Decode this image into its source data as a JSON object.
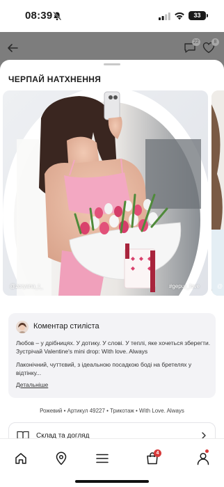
{
  "status_bar": {
    "time": "08:39",
    "battery": "33",
    "icons": [
      "bell-slash-icon",
      "signal-icon",
      "wifi-icon",
      "battery-icon"
    ]
  },
  "header": {
    "back_icon": "arrow-left-icon",
    "chat_badge": "22",
    "favorites_badge": "8"
  },
  "sheet": {
    "title": "ЧЕРПАЙ НАТХНЕННЯ",
    "photo": {
      "author": "@zoryana_t_",
      "hashtag": "#gepur_love",
      "next_author": "@"
    },
    "stylist": {
      "title": "Коментар стиліста",
      "paragraph_1": "Любов – у дрібницях. У дотику. У слові. У теплі, яке хочеться зберегти. Зустрічай Valentine's mini drop: With love. Always",
      "paragraph_2": "Лаконічний, чуттєвий, з ідеальною посадкою боді на бретелях у відтінку...",
      "more_link": "Детальніше"
    },
    "meta": "Рожевий • Артикул 49227 • Трикотаж • With Love. Always",
    "composition_label": "Склад та догляд"
  },
  "tab_bar": {
    "items": [
      "home-icon",
      "location-icon",
      "menu-icon",
      "cart-icon",
      "profile-icon"
    ],
    "cart_badge": "4"
  },
  "colors": {
    "accent": "#d63a3a",
    "card_bg": "#f3f3f6",
    "dim_overlay": "#8a8a8a"
  }
}
